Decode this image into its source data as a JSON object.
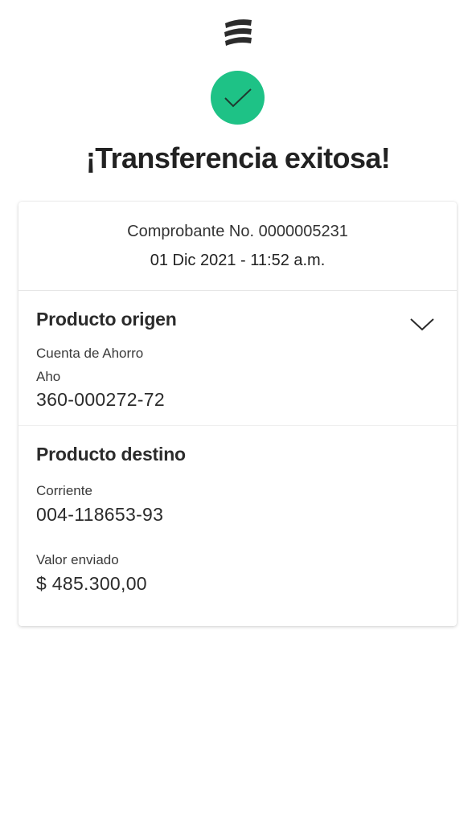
{
  "header": {
    "logo_icon": "bank-logo-icon",
    "success_icon": "check-icon",
    "success_color": "#1ec286",
    "title": "¡Transferencia exitosa!"
  },
  "receipt": {
    "number": "Comprobante No. 0000005231",
    "datetime": "01 Dic 2021 - 11:52 a.m."
  },
  "origin": {
    "title": "Producto origen",
    "expand_icon": "chevron-down-icon",
    "account_type": "Cuenta de Ahorro",
    "account_short": "Aho",
    "account_number": "360-000272-72"
  },
  "destination": {
    "title": "Producto destino",
    "account_type": "Corriente",
    "account_number": "004-118653-93",
    "amount_label": "Valor enviado",
    "amount": "$ 485.300,00"
  }
}
